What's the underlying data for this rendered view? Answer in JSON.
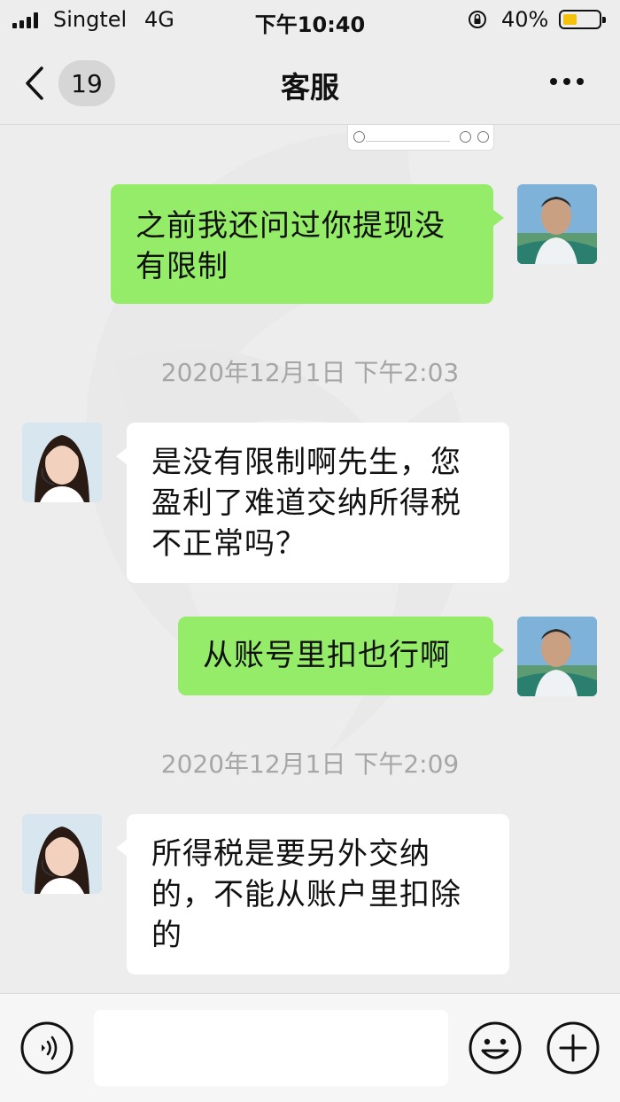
{
  "status_bar": {
    "carrier": "Singtel",
    "network": "4G",
    "time": "下午10:40",
    "battery_percent": "40%",
    "battery_level": 0.4,
    "battery_color": "#f4c20d"
  },
  "nav": {
    "back_icon": "chevron-left-icon",
    "unread_count": "19",
    "title": "客服",
    "more_icon": "ellipsis-icon"
  },
  "messages": [
    {
      "side": "right",
      "text": "之前我还问过你提现没有限制",
      "avatar": "user-avatar"
    },
    {
      "timestamp": "2020年12月1日 下午2:03"
    },
    {
      "side": "left",
      "text": "是没有限制啊先生，您盈利了难道交纳所得税不正常吗？",
      "avatar": "agent-avatar"
    },
    {
      "side": "right",
      "text": "从账号里扣也行啊",
      "avatar": "user-avatar"
    },
    {
      "timestamp": "2020年12月1日 下午2:09"
    },
    {
      "side": "left",
      "text": "所得税是要另外交纳的，不能从账户里扣除的",
      "avatar": "agent-avatar"
    }
  ],
  "input_bar": {
    "voice_icon": "voice-icon",
    "input_value": "",
    "emoji_icon": "emoji-icon",
    "plus_icon": "plus-icon"
  },
  "colors": {
    "sent_bubble": "#95ec69",
    "received_bubble": "#ffffff",
    "background": "#ededed"
  }
}
